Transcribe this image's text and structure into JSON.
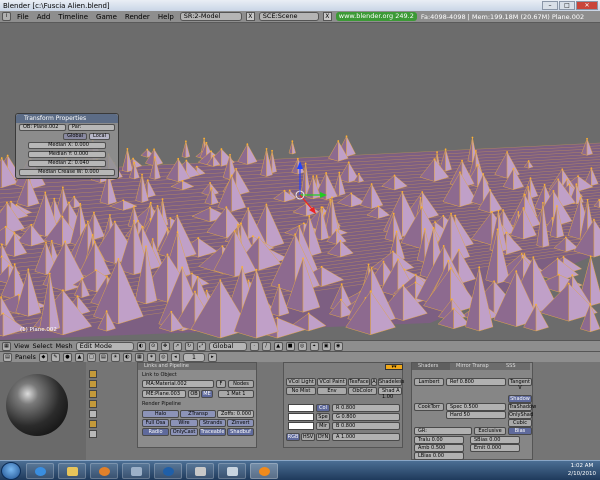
{
  "window": {
    "title": "Blender [c:\\Fuscia Alien.blend]",
    "minimize": "–",
    "maximize": "□",
    "close": "✕"
  },
  "topbar": {
    "menus": [
      "File",
      "Add",
      "Timeline",
      "Game",
      "Render",
      "Help"
    ],
    "screen": "SR:2-Model",
    "scene": "SCE:Scene",
    "url": "www.blender.org 249.2",
    "stats": "Fa:4098-4098 | Mem:199.18M (20.67M) Plane.002",
    "close_glyph": "X"
  },
  "transform_properties": {
    "title": "Transform Properties",
    "ob_field": "OB: Plane.002",
    "par_field": "Par:",
    "global_label": "Global",
    "local_label": "Local",
    "median_x": "Median X: 0.000",
    "median_y": "Median Y: 0.000",
    "median_z": "Median Z: 0.040",
    "median_crease": "Median Crease W: 0.000"
  },
  "viewport": {
    "object_label": "(1) Plane.002"
  },
  "view_header": {
    "menus": [
      "View",
      "Select",
      "Mesh"
    ],
    "mode": "Edit Mode",
    "orientation": "Global"
  },
  "buttons_header": {
    "panels_label": "Panels",
    "frame": "1"
  },
  "link_panel": {
    "tab1": "Links and Pipeline",
    "link_to_object": "Link to Object",
    "material": "MA:Material.002",
    "f_btn": "F",
    "nodes_btn": "Nodes",
    "mesh": "ME:Plane.003",
    "ob_btn": "OB",
    "me_btn": "ME",
    "mat_count": "1 Mat 1",
    "render_pipeline": "Render Pipeline",
    "halo": "Halo",
    "ztransp": "ZTransp",
    "zoffs": "Zoffs: 0.000",
    "full_osa": "Full Osa",
    "wire": "Wire",
    "strands": "Strands",
    "zinvert": "Zinvert",
    "radio": "Radio",
    "onlycast": "OnlyCast",
    "traceable": "Traceable",
    "shadbuf": "Shadbuf"
  },
  "material_panel": {
    "vcol_light": "VCol Light",
    "vcol_paint": "VCol Paint",
    "texface": "TexFace",
    "a_btn": "A",
    "shadeless": "Shadeless",
    "no_mist": "No Mist",
    "env": "Env",
    "obcolor": "ObColor",
    "shad_a": "Shad A 1.00",
    "col": "Col",
    "spe": "Spe",
    "mir": "Mir",
    "r": "R 0.800",
    "g": "G 0.800",
    "b": "B 0.800",
    "rgb": "RGB",
    "hsv": "HSV",
    "dyn": "DYN",
    "alpha": "A 1.000"
  },
  "shaders_panel": {
    "tab_shaders": "Shaders",
    "tab_mirror": "Mirror Transp",
    "tab_sss": "SSS",
    "diffuse": "Lambert",
    "ref": "Ref 0.800",
    "tangent": "Tangent V",
    "specular": "CookTorr",
    "spec": "Spec 0.500",
    "hard": "Hard 50",
    "shadow": "Shadow",
    "trashadow": "TraShadow",
    "onlyshad": "OnlyShad",
    "cubic": "Cubic",
    "bias": "Bias",
    "gr": "GR:",
    "exclusive": "Exclusive",
    "tralu": "Tralu 0.00",
    "sbias": "SBias 0.00",
    "amb": "Amb 0.500",
    "emit": "Emit 0.000",
    "lbias": "LBias 0.00"
  },
  "taskbar": {
    "time": "1:02 AM",
    "date": "2/10/2010"
  },
  "colors": {
    "mesh_face": "#8d6a8f",
    "mesh_edge": "#e0a54a",
    "viewport_bg": "#6c6c6c"
  }
}
